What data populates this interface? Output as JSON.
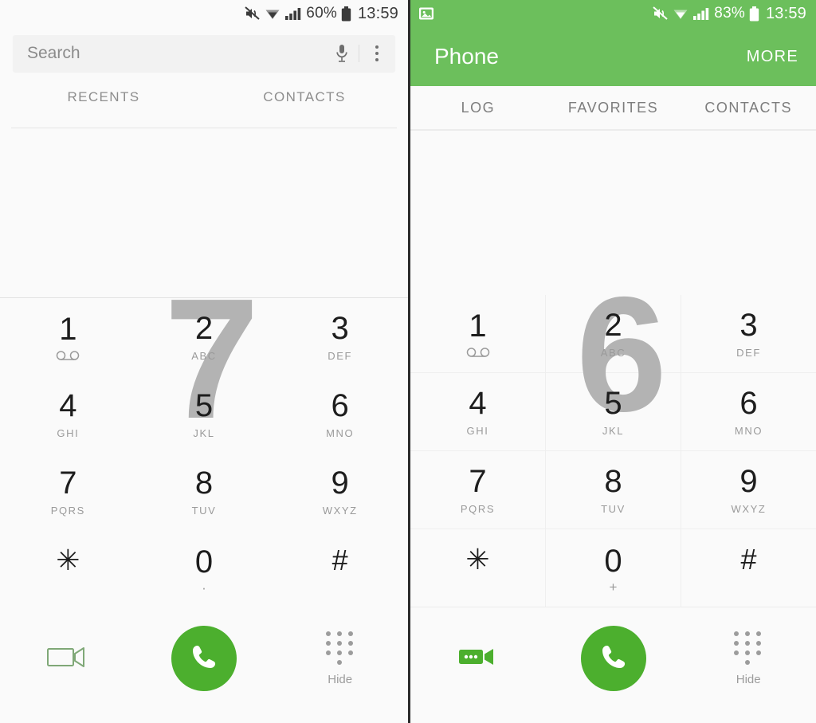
{
  "left_phone": {
    "status_bar": {
      "mute_icon": "mute-icon",
      "wifi_icon": "wifi-icon",
      "signal_icon": "signal-bars-icon",
      "battery_percent": "60%",
      "battery_icon": "battery-icon",
      "clock": "13:59"
    },
    "search": {
      "placeholder": "Search",
      "mic_icon": "microphone-icon",
      "overflow_icon": "more-vertical-icon"
    },
    "tabs": [
      {
        "label": "RECENTS"
      },
      {
        "label": "CONTACTS"
      }
    ],
    "watermark": "7",
    "keypad": [
      {
        "num": "1",
        "sub": "",
        "vm": true
      },
      {
        "num": "2",
        "sub": "ABC"
      },
      {
        "num": "3",
        "sub": "DEF"
      },
      {
        "num": "4",
        "sub": "GHI"
      },
      {
        "num": "5",
        "sub": "JKL"
      },
      {
        "num": "6",
        "sub": "MNO"
      },
      {
        "num": "7",
        "sub": "PQRS"
      },
      {
        "num": "8",
        "sub": "TUV"
      },
      {
        "num": "9",
        "sub": "WXYZ"
      },
      {
        "num": "✳",
        "sub": "",
        "symbol": true
      },
      {
        "num": "0",
        "sub": "·"
      },
      {
        "num": "#",
        "sub": "",
        "symbol": true
      }
    ],
    "actions": {
      "video_call_icon": "video-call-icon",
      "call_icon": "phone-call-icon",
      "hide_keypad_icon": "keypad-dots-icon",
      "hide_label": "Hide"
    }
  },
  "right_phone": {
    "status_bar": {
      "notification_icon": "screenshot-notification-icon",
      "mute_icon": "mute-icon",
      "wifi_icon": "wifi-icon",
      "signal_icon": "signal-bars-icon",
      "battery_percent": "83%",
      "battery_icon": "battery-icon",
      "clock": "13:59"
    },
    "app_bar": {
      "title": "Phone",
      "more_label": "MORE",
      "background_color": "#6cbf5c"
    },
    "tabs": [
      {
        "label": "LOG"
      },
      {
        "label": "FAVORITES"
      },
      {
        "label": "CONTACTS"
      }
    ],
    "watermark": "6",
    "keypad": [
      {
        "num": "1",
        "sub": "",
        "vm": true
      },
      {
        "num": "2",
        "sub": "ABC"
      },
      {
        "num": "3",
        "sub": "DEF"
      },
      {
        "num": "4",
        "sub": "GHI"
      },
      {
        "num": "5",
        "sub": "JKL"
      },
      {
        "num": "6",
        "sub": "MNO"
      },
      {
        "num": "7",
        "sub": "PQRS"
      },
      {
        "num": "8",
        "sub": "TUV"
      },
      {
        "num": "9",
        "sub": "WXYZ"
      },
      {
        "num": "✳",
        "sub": "",
        "symbol": true
      },
      {
        "num": "0",
        "sub": "+"
      },
      {
        "num": "#",
        "sub": "",
        "symbol": true
      }
    ],
    "actions": {
      "video_call_icon": "video-call-icon",
      "call_icon": "phone-call-icon",
      "hide_keypad_icon": "keypad-dots-icon",
      "hide_label": "Hide"
    }
  },
  "colors": {
    "brand_green": "#6cbf5c",
    "call_green": "#4caf2e",
    "page_bg": "#fafafa"
  }
}
